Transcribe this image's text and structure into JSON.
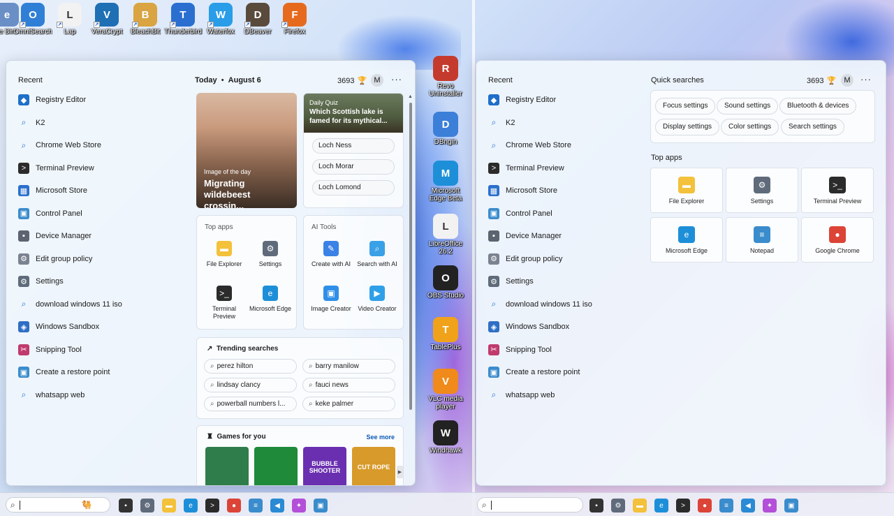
{
  "desktop_top": [
    {
      "label": "e Bin",
      "icon": "recycle-bin-icon",
      "color": "#6a8fc7"
    },
    {
      "label": "OmniSearch",
      "icon": "omnisearch-icon",
      "color": "#2f7fd6"
    },
    {
      "label": "Lap",
      "icon": "lap-icon",
      "color": "#f2f2f2"
    },
    {
      "label": "VeraCrypt",
      "icon": "veracrypt-icon",
      "color": "#1f6fb4"
    },
    {
      "label": "BleachBit",
      "icon": "bleachbit-icon",
      "color": "#d9a441"
    },
    {
      "label": "Thunderbird",
      "icon": "thunderbird-icon",
      "color": "#2a6fd0"
    },
    {
      "label": "Waterfox",
      "icon": "waterfox-icon",
      "color": "#2a9de8"
    },
    {
      "label": "DBeaver",
      "icon": "dbeaver-icon",
      "color": "#5a4a3c"
    },
    {
      "label": "Firefox",
      "icon": "firefox-icon",
      "color": "#e66a1e"
    }
  ],
  "desktop_right": [
    {
      "label": "Revo Uninstaller",
      "icon": "revo-uninstaller-icon",
      "color": "#c43b2e"
    },
    {
      "label": "DBngin",
      "icon": "dbngin-icon",
      "color": "#3b7fd9"
    },
    {
      "label": "Microsoft Edge Beta",
      "icon": "edge-beta-icon",
      "color": "#1d8fd8"
    },
    {
      "label": "LibreOffice 26.2",
      "icon": "libreoffice-icon",
      "color": "#f2f2f2"
    },
    {
      "label": "OBS Studio",
      "icon": "obs-icon",
      "color": "#222222"
    },
    {
      "label": "TablePlus",
      "icon": "tableplus-icon",
      "color": "#f0a21a"
    },
    {
      "label": "VLC media player",
      "icon": "vlc-icon",
      "color": "#f08a1a"
    },
    {
      "label": "Windhawk",
      "icon": "windhawk-icon",
      "color": "#222222"
    }
  ],
  "recent": {
    "title": "Recent",
    "items": [
      {
        "label": "Registry Editor",
        "icon": "registry-editor-icon",
        "color": "#1e6fc9",
        "glyph": "◆"
      },
      {
        "label": "K2",
        "icon": "search-icon",
        "search": true
      },
      {
        "label": "Chrome Web Store",
        "icon": "search-icon",
        "search": true
      },
      {
        "label": "Terminal Preview",
        "icon": "terminal-icon",
        "color": "#2b2b2b",
        "glyph": ">"
      },
      {
        "label": "Microsoft Store",
        "icon": "store-icon",
        "color": "#2a6fcc",
        "glyph": "▦"
      },
      {
        "label": "Control Panel",
        "icon": "control-panel-icon",
        "color": "#3a8ccc",
        "glyph": "▣"
      },
      {
        "label": "Device Manager",
        "icon": "device-manager-icon",
        "color": "#5b6470",
        "glyph": "▪"
      },
      {
        "label": "Edit group policy",
        "icon": "gear-icon",
        "color": "#7b8290",
        "glyph": "⚙"
      },
      {
        "label": "Settings",
        "icon": "settings-icon",
        "color": "#5f6b7a",
        "glyph": "⚙"
      },
      {
        "label": "download windows 11 iso",
        "icon": "search-icon",
        "search": true
      },
      {
        "label": "Windows Sandbox",
        "icon": "sandbox-icon",
        "color": "#2f6ec5",
        "glyph": "◈"
      },
      {
        "label": "Snipping Tool",
        "icon": "snipping-tool-icon",
        "color": "#c03a6e",
        "glyph": "✂"
      },
      {
        "label": "Create a restore point",
        "icon": "restore-point-icon",
        "color": "#3a8ccc",
        "glyph": "▣"
      },
      {
        "label": "whatsapp web",
        "icon": "search-icon",
        "search": true
      }
    ]
  },
  "left_header": {
    "today": "Today",
    "date": "August 6",
    "score": "3693",
    "avatar": "M",
    "more": "···"
  },
  "potd": {
    "small": "Image of the day",
    "title": "Migrating wildebeest crossin..."
  },
  "quiz": {
    "small": "Daily Quiz",
    "question": "Which Scottish lake is famed for its mythical...",
    "options": [
      "Loch Ness",
      "Loch Morar",
      "Loch Lomond"
    ]
  },
  "top_apps_small": {
    "title": "Top apps",
    "items": [
      {
        "label": "File Explorer",
        "icon": "folder-icon",
        "color": "#f3c13a",
        "glyph": "▬"
      },
      {
        "label": "Settings",
        "icon": "settings-icon",
        "color": "#5f6b7a",
        "glyph": "⚙"
      },
      {
        "label": "Terminal Preview",
        "icon": "terminal-icon",
        "color": "#2b2b2b",
        "glyph": ">_"
      },
      {
        "label": "Microsoft Edge",
        "icon": "edge-icon",
        "color": "#1d8fd8",
        "glyph": "e"
      }
    ]
  },
  "ai_tools": {
    "title": "AI Tools",
    "items": [
      {
        "label": "Create with AI",
        "icon": "create-ai-icon",
        "color": "#3b82e6",
        "glyph": "✎"
      },
      {
        "label": "Search with AI",
        "icon": "search-ai-icon",
        "color": "#3aa1e6",
        "glyph": "⌕"
      },
      {
        "label": "Image Creator",
        "icon": "image-creator-icon",
        "color": "#2f8fe8",
        "glyph": "▣"
      },
      {
        "label": "Video Creator",
        "icon": "video-creator-icon",
        "color": "#2fa0e8",
        "glyph": "▶"
      }
    ]
  },
  "trending": {
    "title": "Trending searches",
    "items": [
      "perez hilton",
      "barry manilow",
      "lindsay clancy",
      "fauci news",
      "powerball numbers l...",
      "keke palmer"
    ]
  },
  "games": {
    "title": "Games for you",
    "see_more": "See more",
    "items": [
      {
        "label": "",
        "icon": "mahjong-icon",
        "color": "#2f7d4b"
      },
      {
        "label": "",
        "icon": "solitaire-icon",
        "color": "#1f8a3a"
      },
      {
        "label": "BUBBLE SHOOTER",
        "icon": "bubble-shooter-icon",
        "color": "#6a2fb0"
      },
      {
        "label": "CUT ROPE",
        "icon": "cut-the-rope-icon",
        "color": "#d89a2a"
      }
    ]
  },
  "right_header": {
    "quick_searches": "Quick searches",
    "score": "3693",
    "avatar": "M",
    "more": "···"
  },
  "quick_searches": [
    "Focus settings",
    "Sound settings",
    "Bluetooth & devices",
    "Display settings",
    "Color settings",
    "Search settings"
  ],
  "top_apps_big": {
    "title": "Top apps",
    "items": [
      {
        "label": "File Explorer",
        "icon": "folder-icon",
        "color": "#f3c13a",
        "glyph": "▬"
      },
      {
        "label": "Settings",
        "icon": "settings-icon",
        "color": "#5f6b7a",
        "glyph": "⚙"
      },
      {
        "label": "Terminal Preview",
        "icon": "terminal-icon",
        "color": "#2b2b2b",
        "glyph": ">_"
      },
      {
        "label": "Microsoft Edge",
        "icon": "edge-icon",
        "color": "#1d8fd8",
        "glyph": "e"
      },
      {
        "label": "Notepad",
        "icon": "notepad-icon",
        "color": "#3a8ccc",
        "glyph": "≡"
      },
      {
        "label": "Google Chrome",
        "icon": "chrome-icon",
        "color": "#db4437",
        "glyph": "●"
      }
    ]
  },
  "taskbar_icons": [
    {
      "icon": "task-view-icon",
      "color": "#333333",
      "glyph": "▪"
    },
    {
      "icon": "settings-icon",
      "color": "#5f6b7a",
      "glyph": "⚙"
    },
    {
      "icon": "folder-icon",
      "color": "#f3c13a",
      "glyph": "▬"
    },
    {
      "icon": "edge-icon",
      "color": "#1d8fd8",
      "glyph": "e"
    },
    {
      "icon": "terminal-icon",
      "color": "#2b2b2b",
      "glyph": ">"
    },
    {
      "icon": "chrome-icon",
      "color": "#db4437",
      "glyph": "●"
    },
    {
      "icon": "notepad-icon",
      "color": "#3a8ccc",
      "glyph": "≡"
    },
    {
      "icon": "vscode-icon",
      "color": "#2a8ad4",
      "glyph": "◀"
    },
    {
      "icon": "copilot-icon",
      "color": "#b34fd8",
      "glyph": "✦"
    },
    {
      "icon": "photos-icon",
      "color": "#3a8ccc",
      "glyph": "▣"
    }
  ]
}
